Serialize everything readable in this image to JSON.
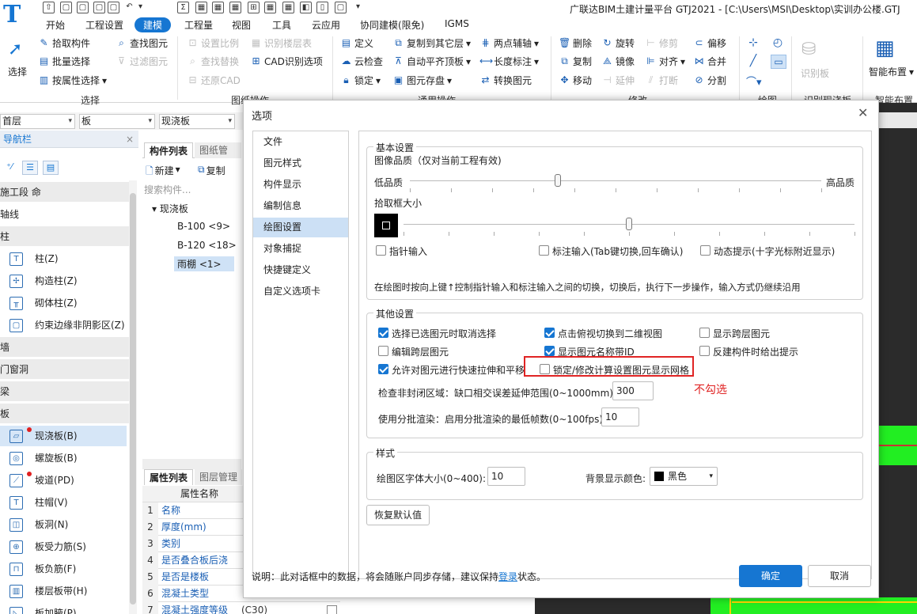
{
  "app": {
    "logo": "T",
    "title": "广联达BIM土建计量平台 GTJ2021 - [C:\\Users\\MSI\\Desktop\\实训办公楼.GTJ"
  },
  "quick_access": [
    "⇧",
    "▢",
    "▢",
    "▢",
    "▢",
    "↶",
    "▾",
    "Σ",
    "▦",
    "▦",
    "▦",
    "⊞",
    "▦",
    "▦",
    "◧",
    "▯",
    "▢",
    "▾"
  ],
  "menu": [
    "开始",
    "工程设置",
    "建模",
    "工程量",
    "视图",
    "工具",
    "云应用",
    "协同建模(限免)",
    "IGMS"
  ],
  "menu_active": "建模",
  "ribbon": {
    "select": {
      "label": "选择",
      "items": [
        "拾取构件",
        "批量选择",
        "按属性选择"
      ],
      "find": "查找图元",
      "filter": "过滤图元",
      "group": "选择"
    },
    "drawing": {
      "items": [
        "设置比例",
        "识别楼层表",
        "查找替换",
        "CAD识别选项",
        "还原CAD"
      ],
      "group": "图纸操作"
    },
    "common": {
      "items": [
        "定义",
        "复制到其它层",
        "两点辅轴",
        "云检查",
        "自动平齐顶板",
        "长度标注",
        "锁定",
        "图元存盘",
        "转换图元"
      ],
      "group": "通用操作"
    },
    "modify": {
      "items": [
        "删除",
        "旋转",
        "修剪",
        "偏移",
        "复制",
        "镜像",
        "对齐",
        "合并",
        "移动",
        "延伸",
        "打断",
        "分割"
      ],
      "group": "修改"
    },
    "draw": {
      "group": "绘图"
    },
    "recog": {
      "label": "识别板",
      "group": "识别现浇板"
    },
    "smart": {
      "label": "智能布置",
      "group": "智能布置"
    }
  },
  "toolbar_dropdowns": [
    "首层",
    "板",
    "现浇板"
  ],
  "nav": {
    "title": "导航栏",
    "categories": [
      "施工段 命",
      "轴线",
      "柱",
      "墙",
      "门窗洞",
      "梁",
      "板"
    ],
    "column_items": [
      "柱(Z)",
      "构造柱(Z)",
      "砌体柱(Z)",
      "约束边缘非阴影区(Z)"
    ],
    "slab_items": [
      "现浇板(B)",
      "螺旋板(B)",
      "坡道(PD)",
      "柱帽(V)",
      "板洞(N)",
      "板受力筋(S)",
      "板负筋(F)",
      "楼层板带(H)",
      "板加腋(P)"
    ],
    "selected": "现浇板(B)"
  },
  "component_list": {
    "tabs": [
      "构件列表",
      "图纸管理"
    ],
    "new_label": "新建",
    "copy_label": "复制",
    "search_placeholder": "搜索构件...",
    "root": "现浇板",
    "items": [
      "B-100 <9>",
      "B-120 <18>",
      "雨棚 <1>"
    ],
    "selected": "雨棚 <1>"
  },
  "prop_list": {
    "tabs": [
      "属性列表",
      "图层管理"
    ],
    "header": "属性名称",
    "rows": [
      {
        "n": "1",
        "name": "名称",
        "value": ""
      },
      {
        "n": "2",
        "name": "厚度(mm)",
        "value": ""
      },
      {
        "n": "3",
        "name": "类别",
        "value": ""
      },
      {
        "n": "4",
        "name": "是否叠合板后浇",
        "value": ""
      },
      {
        "n": "5",
        "name": "是否是楼板",
        "value": ""
      },
      {
        "n": "6",
        "name": "混凝土类型",
        "value": ""
      },
      {
        "n": "7",
        "name": "混凝土强度等级",
        "value": "(C30)"
      }
    ]
  },
  "dialog": {
    "title": "选项",
    "nav": [
      "文件",
      "图元样式",
      "构件显示",
      "编制信息",
      "绘图设置",
      "对象捕捉",
      "快捷键定义",
      "自定义选项卡"
    ],
    "selected": "绘图设置",
    "basic": {
      "legend": "基本设置",
      "image_quality": "图像品质（仅对当前工程有效)",
      "low": "低品质",
      "high": "高品质",
      "quality_level": 0.36,
      "pick_size": "拾取框大小",
      "pick_level": 0.5,
      "checks": [
        {
          "label": "指针输入",
          "checked": false
        },
        {
          "label": "标注输入(Tab键切换,回车确认)",
          "checked": false
        },
        {
          "label": "动态提示(十字光标附近显示)",
          "checked": false
        }
      ],
      "hint": "在绘图时按向上键↑控制指针输入和标注输入之间的切换，切换后，执行下一步操作，输入方式仍继续沿用"
    },
    "other": {
      "legend": "其他设置",
      "checks": [
        {
          "label": "选择已选图元时取消选择",
          "checked": true
        },
        {
          "label": "点击俯视切换到二维视图",
          "checked": true
        },
        {
          "label": "显示跨层图元",
          "checked": false
        },
        {
          "label": "编辑跨层图元",
          "checked": false
        },
        {
          "label": "显示图元名称带ID",
          "checked": true
        },
        {
          "label": "反建构件时给出提示",
          "checked": false
        },
        {
          "label": "允许对图元进行快速拉伸和平移",
          "checked": true
        },
        {
          "label": "锁定/修改计算设置图元显示网格",
          "checked": false
        }
      ],
      "gap_label": "检查非封闭区域：缺口相交误差延伸范围(0~1000mm):",
      "gap_value": "300",
      "batch_label": "使用分批渲染：启用分批渲染的最低帧数(0~100fps):",
      "batch_value": "10"
    },
    "style": {
      "legend": "样式",
      "font_label": "绘图区字体大小(0~400):",
      "font_value": "10",
      "bg_label": "背景显示颜色:",
      "bg_value": "黑色"
    },
    "restore": "恢复默认值",
    "note_prefix": "说明：此对话框中的数据，将会随账户同步存储，建议保持",
    "note_link": "登录",
    "note_suffix": "状态。",
    "ok": "确定",
    "cancel": "取消"
  },
  "annotation": "不勾选",
  "colors": {
    "accent": "#1676d2",
    "annotation": "#e02424",
    "canvas": "#2b2b2b",
    "green": "#22ee22"
  }
}
